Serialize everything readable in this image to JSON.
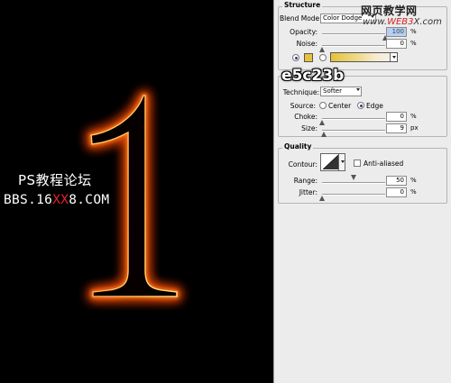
{
  "canvas": {
    "numeral": "1",
    "watermark_cn": "PS教程论坛",
    "watermark_url_prefix": "BBS.16",
    "watermark_url_highlight": "XX",
    "watermark_url_suffix": "8.COM"
  },
  "overlay": {
    "site_cn": "网页教学网",
    "site_url_prefix": "www.",
    "site_url_mid": "WEB3",
    "site_url_suffix": "X.com",
    "hex_label": "e5c23b"
  },
  "structure": {
    "title": "Structure",
    "blend_mode_label": "Blend Mode:",
    "blend_mode_value": "Color Dodge",
    "opacity_label": "Opacity:",
    "opacity_value": "100",
    "opacity_unit": "%",
    "opacity_fraction": 1.0,
    "noise_label": "Noise:",
    "noise_value": "0",
    "noise_unit": "%",
    "noise_fraction": 0.0,
    "glow_color": "#e5c23b"
  },
  "elements": {
    "technique_label": "Technique:",
    "technique_value": "Softer",
    "source_label": "Source:",
    "source_center": "Center",
    "source_edge": "Edge",
    "choke_label": "Choke:",
    "choke_value": "0",
    "choke_unit": "%",
    "choke_fraction": 0.0,
    "size_label": "Size:",
    "size_value": "9",
    "size_unit": "px",
    "size_fraction": 0.04
  },
  "quality": {
    "title": "Quality",
    "contour_label": "Contour:",
    "anti_aliased_label": "Anti-aliased",
    "range_label": "Range:",
    "range_value": "50",
    "range_unit": "%",
    "range_fraction": 0.5,
    "jitter_label": "Jitter:",
    "jitter_value": "0",
    "jitter_unit": "%",
    "jitter_fraction": 0.0
  }
}
